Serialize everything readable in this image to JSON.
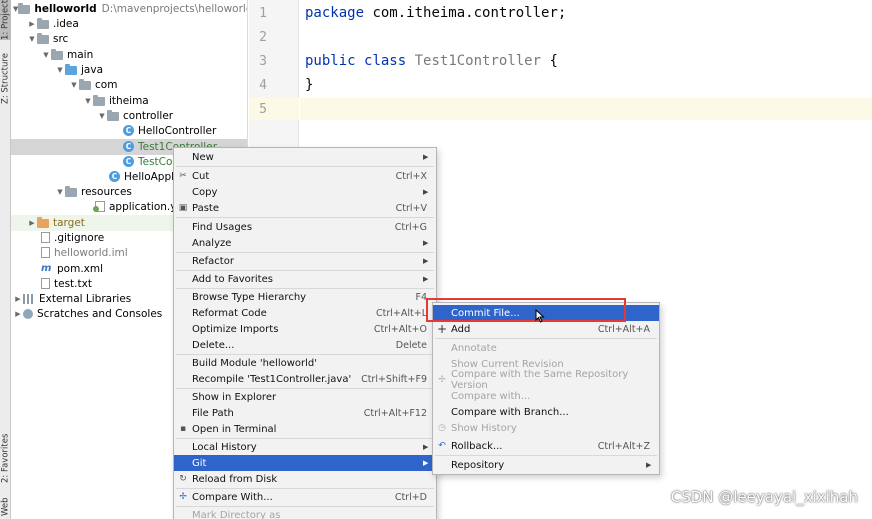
{
  "tool_stripe": {
    "project_tab": "1: Project",
    "structure_tab": "Z: Structure",
    "favorites_tab": "2: Favorites",
    "web_tab": "Web"
  },
  "tree": {
    "root_name": "helloworld",
    "root_path": "D:\\mavenprojects\\helloworld",
    "idea": ".idea",
    "src": "src",
    "main": "main",
    "java": "java",
    "com": "com",
    "itheima": "itheima",
    "controller": "controller",
    "hello_controller": "HelloController",
    "test1_controller": "Test1Controller",
    "test_controller": "TestCon",
    "hello_app": "HelloAppli",
    "resources": "resources",
    "application_yml": "application.yml",
    "target": "target",
    "gitignore": ".gitignore",
    "helloworld_iml": "helloworld.iml",
    "pom": "pom.xml",
    "test_txt": "test.txt",
    "external_libraries": "External Libraries",
    "scratches": "Scratches and Consoles"
  },
  "editor": {
    "line_numbers": [
      "1",
      "2",
      "3",
      "4",
      "5"
    ],
    "line1_kw": "package",
    "line1_rest": " com.itheima.controller;",
    "line3_kw1": "public",
    "line3_kw2": "class",
    "line3_name": "Test1Controller",
    "line3_rest": " {",
    "line4": "}"
  },
  "context_menu": {
    "new": "New",
    "cut": "Cut",
    "cut_sc": "Ctrl+X",
    "copy": "Copy",
    "paste": "Paste",
    "paste_sc": "Ctrl+V",
    "find_usages": "Find Usages",
    "find_usages_sc": "Ctrl+G",
    "analyze": "Analyze",
    "refactor": "Refactor",
    "add_favorites": "Add to Favorites",
    "browse_hierarchy": "Browse Type Hierarchy",
    "browse_hierarchy_sc": "F4",
    "reformat": "Reformat Code",
    "reformat_sc": "Ctrl+Alt+L",
    "optimize": "Optimize Imports",
    "optimize_sc": "Ctrl+Alt+O",
    "delete": "Delete...",
    "delete_sc": "Delete",
    "build_module": "Build Module 'helloworld'",
    "recompile": "Recompile 'Test1Controller.java'",
    "recompile_sc": "Ctrl+Shift+F9",
    "show_explorer": "Show in Explorer",
    "file_path": "File Path",
    "file_path_sc": "Ctrl+Alt+F12",
    "open_terminal": "Open in Terminal",
    "local_history": "Local History",
    "git": "Git",
    "reload": "Reload from Disk",
    "compare_with": "Compare With...",
    "compare_with_sc": "Ctrl+D",
    "mark_directory": "Mark Directory as"
  },
  "git_menu": {
    "commit_file": "Commit File...",
    "add": "Add",
    "add_sc": "Ctrl+Alt+A",
    "annotate": "Annotate",
    "show_current_revision": "Show Current Revision",
    "compare_same_repo": "Compare with the Same Repository Version",
    "compare_with": "Compare with...",
    "compare_branch": "Compare with Branch...",
    "show_history": "Show History",
    "rollback": "Rollback...",
    "rollback_sc": "Ctrl+Alt+Z",
    "repository": "Repository"
  },
  "watermark": "CSDN @leeyayai_xixihah",
  "colors": {
    "accent": "#2f65ca",
    "highlight_border": "#e53935",
    "keyword": "#0033b3"
  }
}
